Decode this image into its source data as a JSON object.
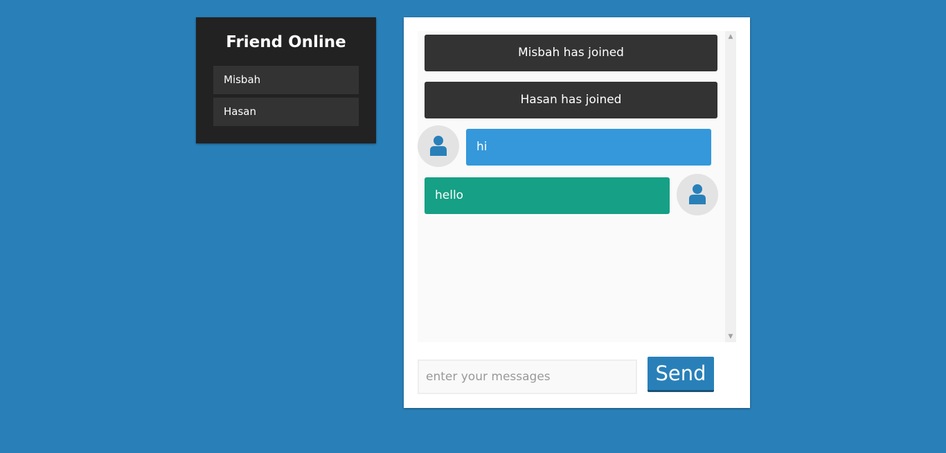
{
  "friends": {
    "title": "Friend Online",
    "items": [
      "Misbah",
      "Hasan"
    ]
  },
  "chat": {
    "notices": [
      "Misbah has joined",
      "Hasan has joined"
    ],
    "messages": [
      {
        "text": "hi",
        "side": "incoming",
        "avatar_icon": "user-icon"
      },
      {
        "text": "hello",
        "side": "outgoing",
        "avatar_icon": "user-icon"
      }
    ]
  },
  "composer": {
    "placeholder": "enter your messages",
    "value": "",
    "send_label": "Send"
  },
  "colors": {
    "background": "#2980b9",
    "panel_dark": "#222222",
    "item_dark": "#333333",
    "incoming_bubble": "#3498db",
    "outgoing_bubble": "#16a085",
    "avatar_icon": "#2980b9"
  }
}
